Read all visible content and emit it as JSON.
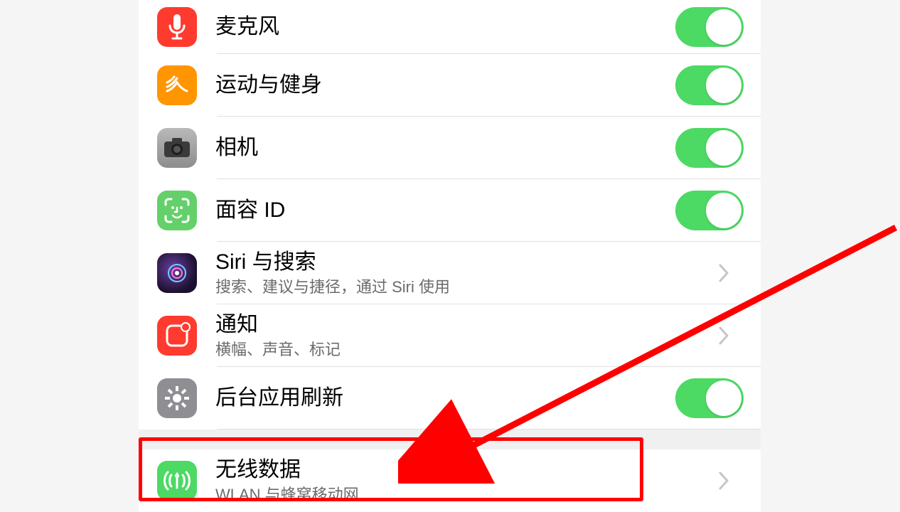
{
  "rows": {
    "microphone": {
      "label": "麦克风"
    },
    "fitness": {
      "label": "运动与健身"
    },
    "camera": {
      "label": "相机"
    },
    "faceid": {
      "label": "面容 ID"
    },
    "siri": {
      "label": "Siri 与搜索",
      "subtitle": "搜索、建议与捷径，通过 Siri 使用"
    },
    "notifications": {
      "label": "通知",
      "subtitle": "横幅、声音、标记"
    },
    "background": {
      "label": "后台应用刷新"
    },
    "wireless": {
      "label": "无线数据",
      "subtitle": "WLAN 与蜂窝移动网"
    }
  },
  "toggles": {
    "microphone": "on",
    "fitness": "on",
    "camera": "on",
    "faceid": "on",
    "background": "on"
  }
}
